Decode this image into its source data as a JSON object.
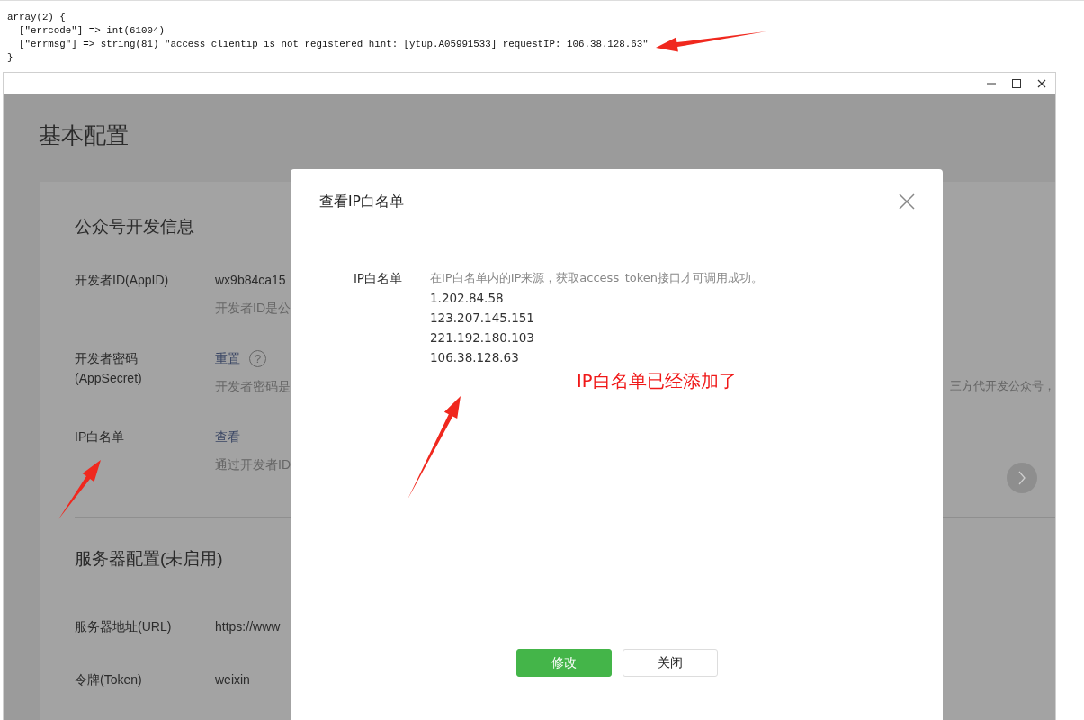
{
  "console_output": {
    "lines": [
      "array(2) {",
      "  [\"errcode\"] => int(61004)",
      "  [\"errmsg\"] => string(81) \"access clientip is not registered hint: [ytup.A05991533] requestIP: 106.38.128.63\"",
      "}"
    ]
  },
  "page": {
    "title": "基本配置",
    "sections": [
      {
        "title": "公众号开发信息",
        "rows": [
          {
            "label": "开发者ID(AppID)",
            "value": "wx9b84ca15",
            "kind": "text",
            "description": "开发者ID是公"
          },
          {
            "label": "开发者密码 (AppSecret)",
            "value": "重置",
            "kind": "link",
            "help_icon": "?",
            "description": "开发者密码是",
            "description_end": "三方代开发公众号，"
          },
          {
            "label": "IP白名单",
            "value": "查看",
            "kind": "link",
            "description": "通过开发者ID"
          }
        ]
      },
      {
        "title": "服务器配置(未启用)",
        "rows": [
          {
            "label": "服务器地址(URL)",
            "value": "https://www",
            "kind": "text"
          },
          {
            "label": "令牌(Token)",
            "value": "weixin",
            "kind": "text"
          }
        ]
      }
    ]
  },
  "dialog": {
    "title": "查看IP白名单",
    "field_label": "IP白名单",
    "hint": "在IP白名单内的IP来源，获取access_token接口才可调用成功。",
    "ips": [
      "1.202.84.58",
      "123.207.145.151",
      "221.192.180.103",
      "106.38.128.63"
    ],
    "buttons": [
      {
        "label": "修改",
        "kind": "primary"
      },
      {
        "label": "关闭",
        "kind": "default"
      }
    ]
  },
  "annotation": {
    "note": "IP白名单已经添加了"
  }
}
